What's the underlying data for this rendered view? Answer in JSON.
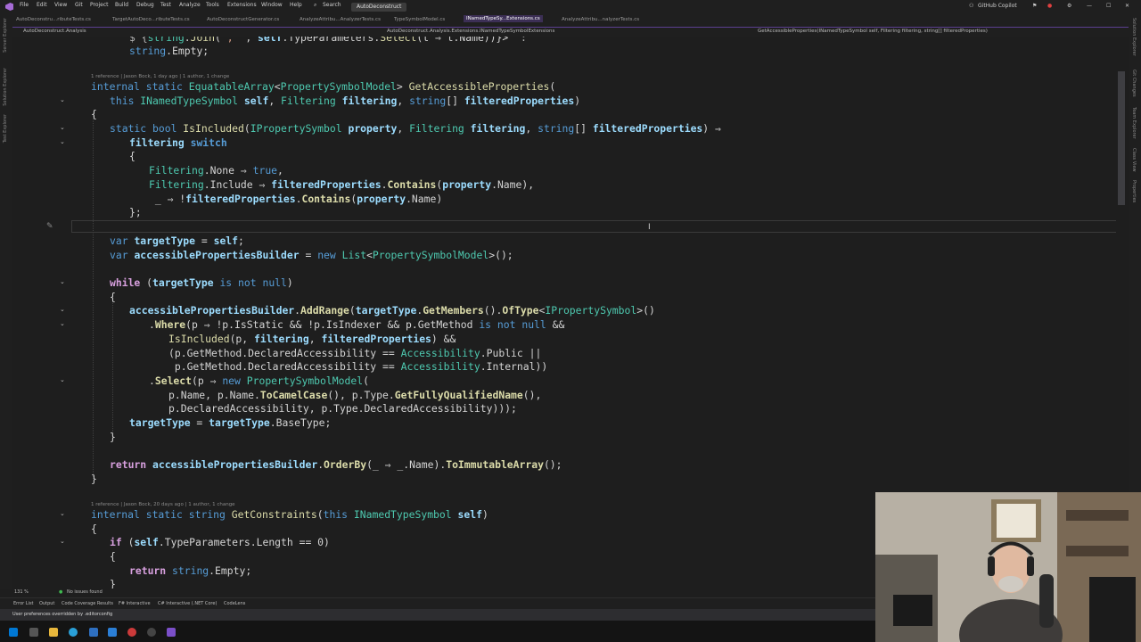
{
  "titlebar": {
    "menus": [
      "File",
      "Edit",
      "View",
      "Git",
      "Project",
      "Build",
      "Debug",
      "Test",
      "Analyze",
      "Tools",
      "Extensions",
      "Window",
      "Help"
    ],
    "search": "Search",
    "solution": "AutoDeconstruct",
    "copilot": "GitHub Copilot"
  },
  "tabs": [
    {
      "label": "AutoDeconstru...ributeTests.cs",
      "active": false
    },
    {
      "label": "TargetAutoDeco...ributeTests.cs",
      "active": false
    },
    {
      "label": "AutoDeconstructGenerator.cs",
      "active": false
    },
    {
      "label": "AnalyzeAttribu...AnalyzerTests.cs",
      "active": false
    },
    {
      "label": "TypeSymbolModel.cs",
      "active": false
    },
    {
      "label": "INamedTypeSy...Extensions.cs",
      "active": true
    },
    {
      "label": "AnalyzeAttribu...nalyzerTests.cs",
      "active": false
    }
  ],
  "navbar": {
    "project": "AutoDeconstruct.Analysis",
    "type": "AutoDeconstruct.Analysis.Extensions.INamedTypeSymbolExtensions",
    "member": "GetAccessibleProperties(INamedTypeSymbol self, Filtering filtering, string[] filteredProperties)"
  },
  "codelens": {
    "first": "1 reference | Jason Bock, 1 day ago | 1 author, 1 change",
    "second": "1 reference | Jason Bock, 20 days ago | 1 author, 1 change"
  },
  "editor_status": {
    "zoom": "131 %",
    "issues": "No issues found"
  },
  "tool_tabs": [
    "Error List",
    "Output",
    "Code Coverage Results",
    "F# Interactive",
    "C# Interactive (.NET Core)",
    "CodeLens"
  ],
  "status_text": "User preferences overridden by .editorconfig",
  "colors": {
    "accent": "#5c3f8f",
    "keyword": "#569cd6",
    "type": "#4ec9b0",
    "method": "#dcdcaa",
    "variable": "#9cdcfe",
    "control": "#d8a0df"
  }
}
